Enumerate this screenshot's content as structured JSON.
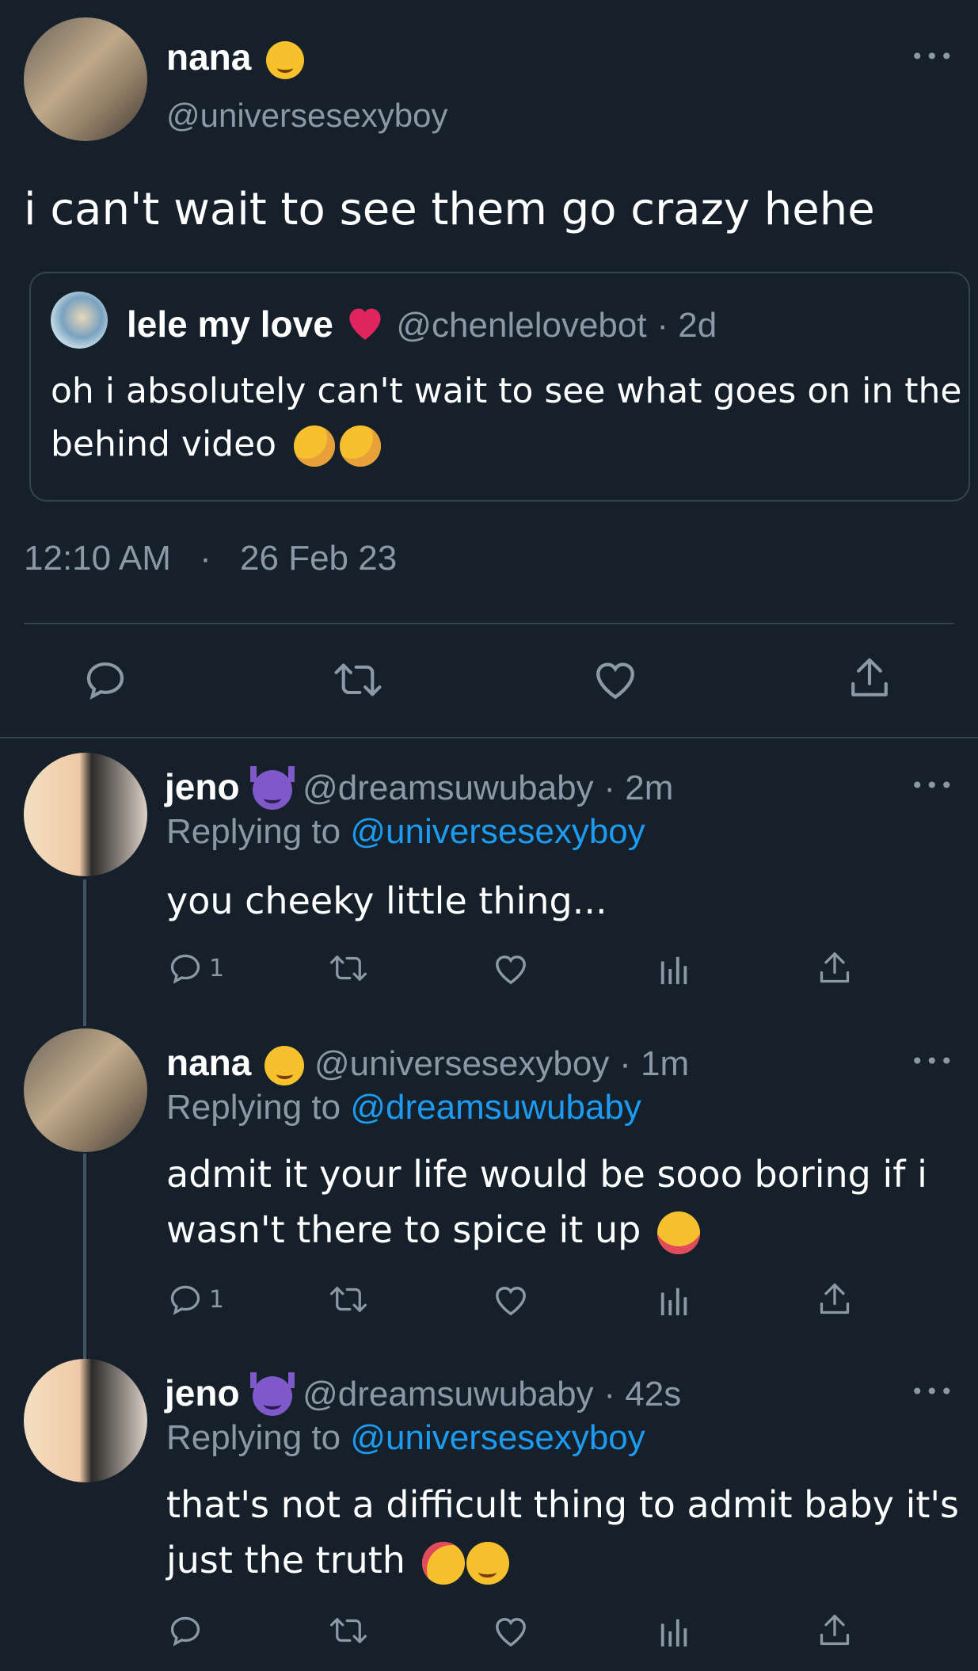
{
  "main_tweet": {
    "name": "nana",
    "handle": "@universesexyboy",
    "text": "i can't wait to see them go crazy hehe",
    "quote": {
      "name": "lele my love",
      "handle": "@chenlelovebot",
      "time": "· 2d",
      "text_line1": "oh i absolutely can't wait to see what goes on in the",
      "text_line2": "behind video"
    },
    "time": "12:10 AM",
    "sep": "·",
    "date": "26 Feb 23"
  },
  "replies": [
    {
      "name": "jeno",
      "handle": "@dreamsuwubaby",
      "time": "· 2m",
      "replying_label": "Replying to",
      "replying_handle": "@universesexyboy",
      "text_line1": "you cheeky little thing...",
      "text_line2": "",
      "reply_count": "1"
    },
    {
      "name": "nana",
      "handle": "@universesexyboy",
      "time": "· 1m",
      "replying_label": "Replying to",
      "replying_handle": "@dreamsuwubaby",
      "text_line1": "admit it your life would be sooo boring if i",
      "text_line2": "wasn't there to spice it up",
      "reply_count": "1"
    },
    {
      "name": "jeno",
      "handle": "@dreamsuwubaby",
      "time": "· 42s",
      "replying_label": "Replying to",
      "replying_handle": "@universesexyboy",
      "text_line1": "that's not a difficult thing to admit baby it's",
      "text_line2": "just the truth",
      "reply_count": ""
    }
  ],
  "colors": {
    "background": "#15202b",
    "text": "#ffffff",
    "muted": "#8b98a5",
    "link": "#1d9bf0",
    "divider": "#38444d"
  }
}
